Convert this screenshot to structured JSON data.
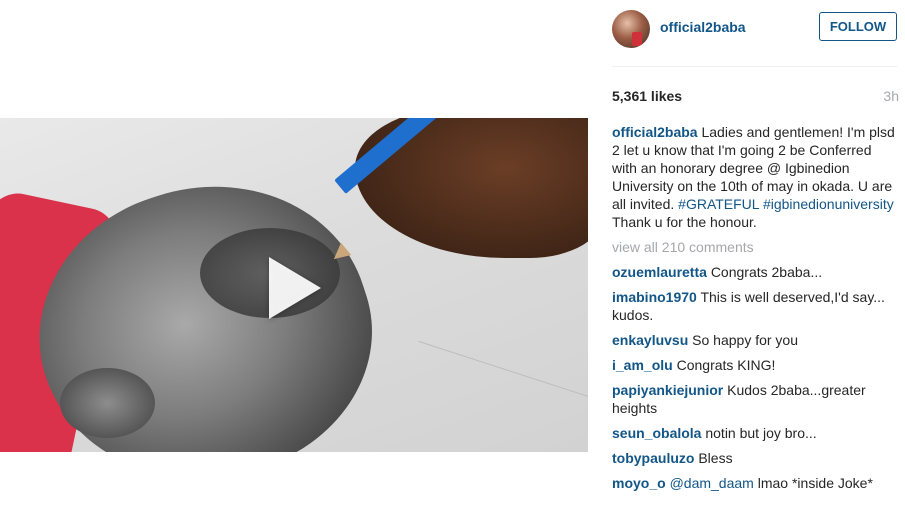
{
  "post": {
    "username": "official2baba",
    "follow_label": "FOLLOW",
    "likes": "5,361 likes",
    "time": "3h"
  },
  "caption": {
    "username": "official2baba",
    "text": "Ladies and gentlemen! I'm plsd 2 let u know that I'm going 2 be Conferred with an honorary degree @ Igbinedion University on the 10th of may in okada. U are all invited.",
    "hashtag1": "#GRATEFUL",
    "hashtag2": "#igbinedionuniversity",
    "text_end": "Thank u for the honour."
  },
  "view_all": "view all 210 comments",
  "comments": [
    {
      "user": "ozuemlauretta",
      "text": "Congrats 2baba..."
    },
    {
      "user": "imabino1970",
      "text": "This is well deserved,I'd say... kudos."
    },
    {
      "user": "enkayluvsu",
      "text": "So happy for you"
    },
    {
      "user": "i_am_olu",
      "text": "Congrats KING!"
    },
    {
      "user": "papiyankiejunior",
      "text": "Kudos 2baba...greater heights"
    },
    {
      "user": "seun_obalola",
      "text": "notin but joy bro..."
    },
    {
      "user": "tobypauluzo",
      "text": "Bless"
    },
    {
      "user": "moyo_o",
      "mention": "@dam_daam",
      "text": "lmao *inside Joke*"
    }
  ],
  "icons": {
    "play": "play-icon",
    "avatar": "avatar"
  }
}
